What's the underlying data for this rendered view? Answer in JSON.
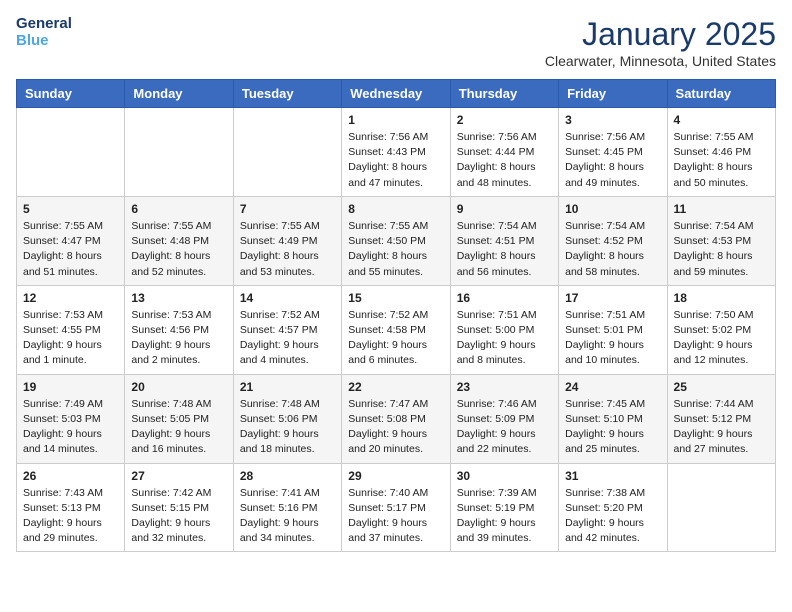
{
  "header": {
    "logo_line1": "General",
    "logo_line2": "Blue",
    "month": "January 2025",
    "location": "Clearwater, Minnesota, United States"
  },
  "weekdays": [
    "Sunday",
    "Monday",
    "Tuesday",
    "Wednesday",
    "Thursday",
    "Friday",
    "Saturday"
  ],
  "weeks": [
    [
      {
        "day": "",
        "sunrise": "",
        "sunset": "",
        "daylight": ""
      },
      {
        "day": "",
        "sunrise": "",
        "sunset": "",
        "daylight": ""
      },
      {
        "day": "",
        "sunrise": "",
        "sunset": "",
        "daylight": ""
      },
      {
        "day": "1",
        "sunrise": "Sunrise: 7:56 AM",
        "sunset": "Sunset: 4:43 PM",
        "daylight": "Daylight: 8 hours and 47 minutes."
      },
      {
        "day": "2",
        "sunrise": "Sunrise: 7:56 AM",
        "sunset": "Sunset: 4:44 PM",
        "daylight": "Daylight: 8 hours and 48 minutes."
      },
      {
        "day": "3",
        "sunrise": "Sunrise: 7:56 AM",
        "sunset": "Sunset: 4:45 PM",
        "daylight": "Daylight: 8 hours and 49 minutes."
      },
      {
        "day": "4",
        "sunrise": "Sunrise: 7:55 AM",
        "sunset": "Sunset: 4:46 PM",
        "daylight": "Daylight: 8 hours and 50 minutes."
      }
    ],
    [
      {
        "day": "5",
        "sunrise": "Sunrise: 7:55 AM",
        "sunset": "Sunset: 4:47 PM",
        "daylight": "Daylight: 8 hours and 51 minutes."
      },
      {
        "day": "6",
        "sunrise": "Sunrise: 7:55 AM",
        "sunset": "Sunset: 4:48 PM",
        "daylight": "Daylight: 8 hours and 52 minutes."
      },
      {
        "day": "7",
        "sunrise": "Sunrise: 7:55 AM",
        "sunset": "Sunset: 4:49 PM",
        "daylight": "Daylight: 8 hours and 53 minutes."
      },
      {
        "day": "8",
        "sunrise": "Sunrise: 7:55 AM",
        "sunset": "Sunset: 4:50 PM",
        "daylight": "Daylight: 8 hours and 55 minutes."
      },
      {
        "day": "9",
        "sunrise": "Sunrise: 7:54 AM",
        "sunset": "Sunset: 4:51 PM",
        "daylight": "Daylight: 8 hours and 56 minutes."
      },
      {
        "day": "10",
        "sunrise": "Sunrise: 7:54 AM",
        "sunset": "Sunset: 4:52 PM",
        "daylight": "Daylight: 8 hours and 58 minutes."
      },
      {
        "day": "11",
        "sunrise": "Sunrise: 7:54 AM",
        "sunset": "Sunset: 4:53 PM",
        "daylight": "Daylight: 8 hours and 59 minutes."
      }
    ],
    [
      {
        "day": "12",
        "sunrise": "Sunrise: 7:53 AM",
        "sunset": "Sunset: 4:55 PM",
        "daylight": "Daylight: 9 hours and 1 minute."
      },
      {
        "day": "13",
        "sunrise": "Sunrise: 7:53 AM",
        "sunset": "Sunset: 4:56 PM",
        "daylight": "Daylight: 9 hours and 2 minutes."
      },
      {
        "day": "14",
        "sunrise": "Sunrise: 7:52 AM",
        "sunset": "Sunset: 4:57 PM",
        "daylight": "Daylight: 9 hours and 4 minutes."
      },
      {
        "day": "15",
        "sunrise": "Sunrise: 7:52 AM",
        "sunset": "Sunset: 4:58 PM",
        "daylight": "Daylight: 9 hours and 6 minutes."
      },
      {
        "day": "16",
        "sunrise": "Sunrise: 7:51 AM",
        "sunset": "Sunset: 5:00 PM",
        "daylight": "Daylight: 9 hours and 8 minutes."
      },
      {
        "day": "17",
        "sunrise": "Sunrise: 7:51 AM",
        "sunset": "Sunset: 5:01 PM",
        "daylight": "Daylight: 9 hours and 10 minutes."
      },
      {
        "day": "18",
        "sunrise": "Sunrise: 7:50 AM",
        "sunset": "Sunset: 5:02 PM",
        "daylight": "Daylight: 9 hours and 12 minutes."
      }
    ],
    [
      {
        "day": "19",
        "sunrise": "Sunrise: 7:49 AM",
        "sunset": "Sunset: 5:03 PM",
        "daylight": "Daylight: 9 hours and 14 minutes."
      },
      {
        "day": "20",
        "sunrise": "Sunrise: 7:48 AM",
        "sunset": "Sunset: 5:05 PM",
        "daylight": "Daylight: 9 hours and 16 minutes."
      },
      {
        "day": "21",
        "sunrise": "Sunrise: 7:48 AM",
        "sunset": "Sunset: 5:06 PM",
        "daylight": "Daylight: 9 hours and 18 minutes."
      },
      {
        "day": "22",
        "sunrise": "Sunrise: 7:47 AM",
        "sunset": "Sunset: 5:08 PM",
        "daylight": "Daylight: 9 hours and 20 minutes."
      },
      {
        "day": "23",
        "sunrise": "Sunrise: 7:46 AM",
        "sunset": "Sunset: 5:09 PM",
        "daylight": "Daylight: 9 hours and 22 minutes."
      },
      {
        "day": "24",
        "sunrise": "Sunrise: 7:45 AM",
        "sunset": "Sunset: 5:10 PM",
        "daylight": "Daylight: 9 hours and 25 minutes."
      },
      {
        "day": "25",
        "sunrise": "Sunrise: 7:44 AM",
        "sunset": "Sunset: 5:12 PM",
        "daylight": "Daylight: 9 hours and 27 minutes."
      }
    ],
    [
      {
        "day": "26",
        "sunrise": "Sunrise: 7:43 AM",
        "sunset": "Sunset: 5:13 PM",
        "daylight": "Daylight: 9 hours and 29 minutes."
      },
      {
        "day": "27",
        "sunrise": "Sunrise: 7:42 AM",
        "sunset": "Sunset: 5:15 PM",
        "daylight": "Daylight: 9 hours and 32 minutes."
      },
      {
        "day": "28",
        "sunrise": "Sunrise: 7:41 AM",
        "sunset": "Sunset: 5:16 PM",
        "daylight": "Daylight: 9 hours and 34 minutes."
      },
      {
        "day": "29",
        "sunrise": "Sunrise: 7:40 AM",
        "sunset": "Sunset: 5:17 PM",
        "daylight": "Daylight: 9 hours and 37 minutes."
      },
      {
        "day": "30",
        "sunrise": "Sunrise: 7:39 AM",
        "sunset": "Sunset: 5:19 PM",
        "daylight": "Daylight: 9 hours and 39 minutes."
      },
      {
        "day": "31",
        "sunrise": "Sunrise: 7:38 AM",
        "sunset": "Sunset: 5:20 PM",
        "daylight": "Daylight: 9 hours and 42 minutes."
      },
      {
        "day": "",
        "sunrise": "",
        "sunset": "",
        "daylight": ""
      }
    ]
  ]
}
